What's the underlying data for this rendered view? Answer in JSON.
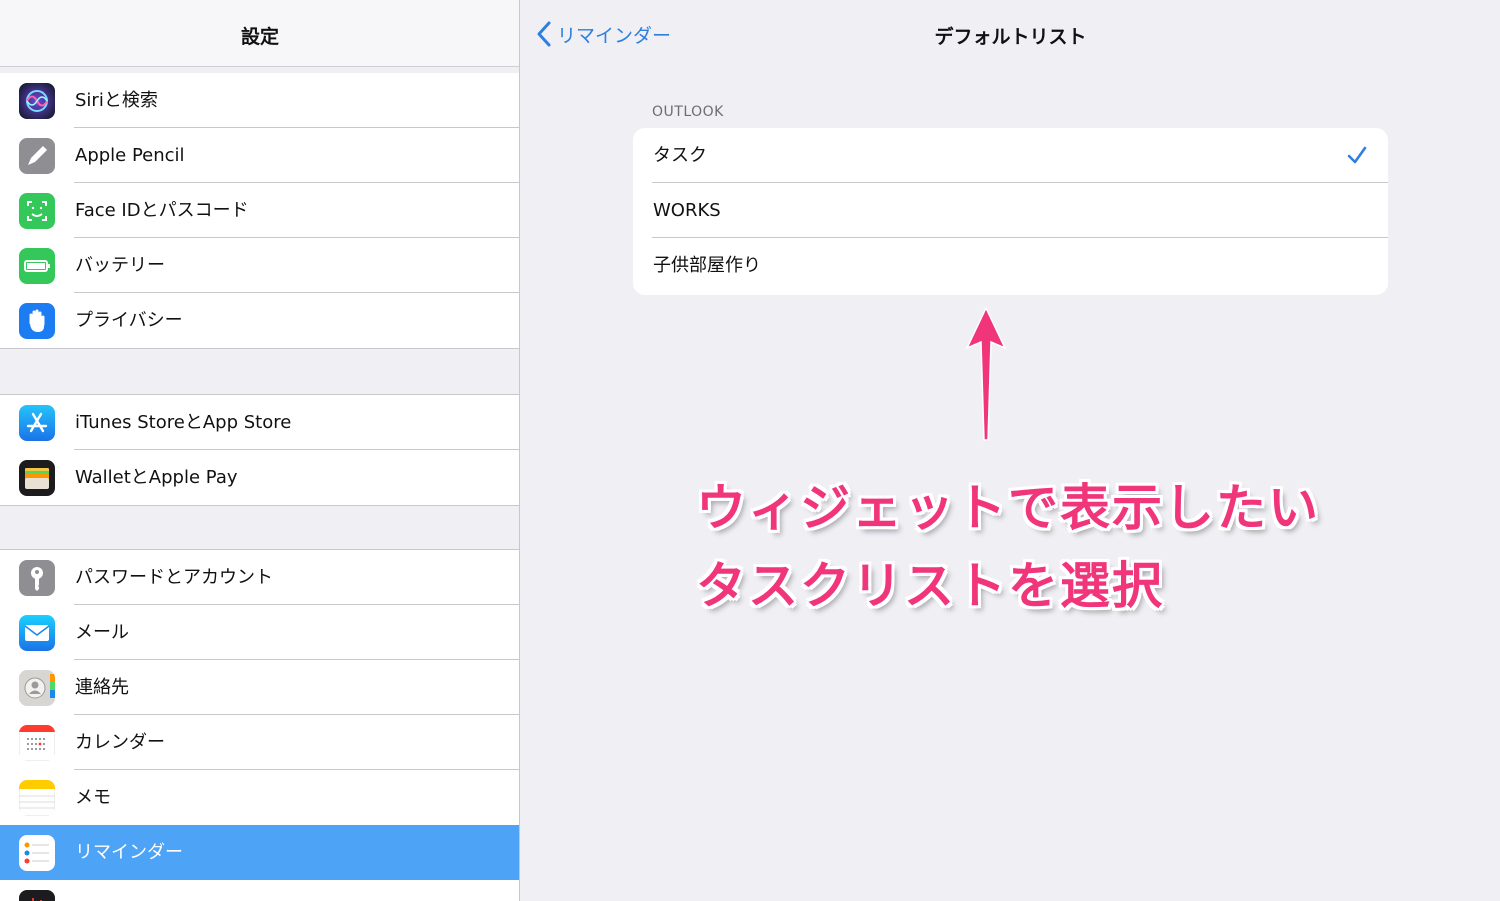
{
  "sidebar": {
    "title": "設定",
    "groups": [
      {
        "items": [
          {
            "label": "Siriと検索",
            "icon": "siri-icon"
          },
          {
            "label": "Apple Pencil",
            "icon": "pencil-icon"
          },
          {
            "label": "Face IDとパスコード",
            "icon": "face-id-icon"
          },
          {
            "label": "バッテリー",
            "icon": "battery-icon"
          },
          {
            "label": "プライバシー",
            "icon": "hand-icon"
          }
        ]
      },
      {
        "items": [
          {
            "label": "iTunes StoreとApp Store",
            "icon": "app-store-icon"
          },
          {
            "label": "WalletとApple Pay",
            "icon": "wallet-icon"
          }
        ]
      },
      {
        "items": [
          {
            "label": "パスワードとアカウント",
            "icon": "key-icon"
          },
          {
            "label": "メール",
            "icon": "mail-icon"
          },
          {
            "label": "連絡先",
            "icon": "contacts-icon"
          },
          {
            "label": "カレンダー",
            "icon": "calendar-icon"
          },
          {
            "label": "メモ",
            "icon": "notes-icon"
          },
          {
            "label": "リマインダー",
            "icon": "reminders-icon",
            "selected": true
          }
        ]
      }
    ]
  },
  "detail": {
    "back_label": "リマインダー",
    "title": "デフォルトリスト",
    "section_header": "OUTLOOK",
    "lists": [
      {
        "label": "タスク",
        "checked": true
      },
      {
        "label": "WORKS",
        "checked": false
      },
      {
        "label": "子供部屋作り",
        "checked": false
      }
    ]
  },
  "annotation": {
    "line1": "ウィジェットで表示したい",
    "line2": "タスクリストを選択",
    "color": "#f0357a"
  },
  "colors": {
    "accent": "#2f7fe0",
    "selected_row": "#4da3f5"
  }
}
